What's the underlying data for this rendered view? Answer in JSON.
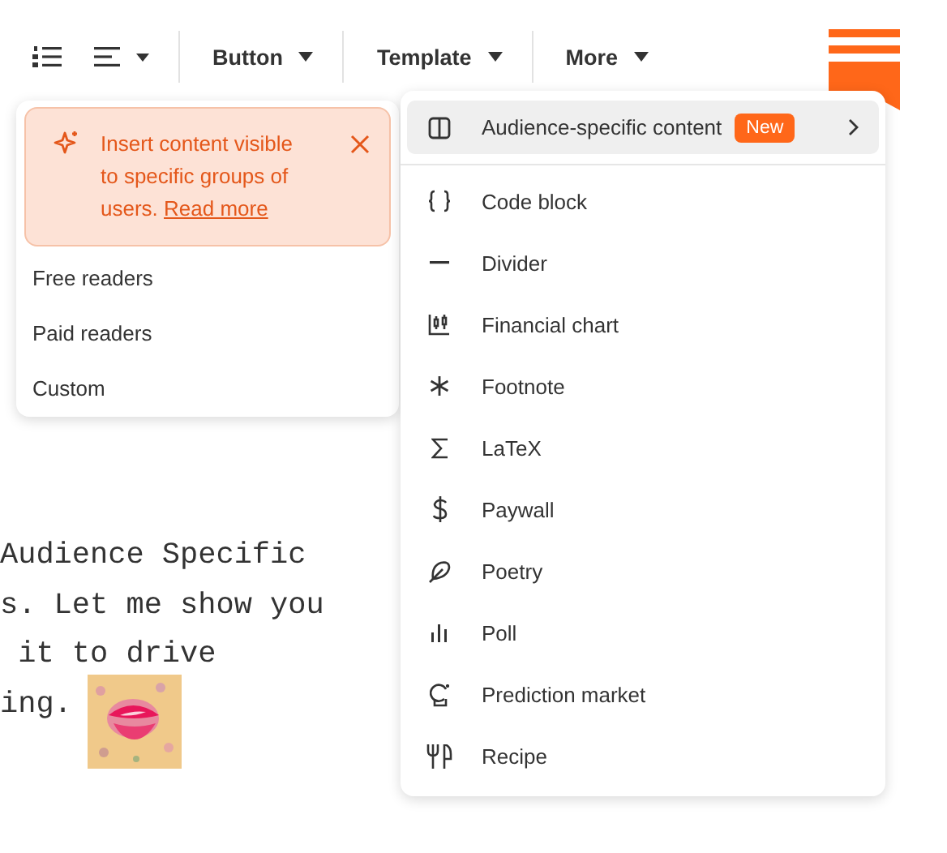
{
  "toolbar": {
    "items": [
      {
        "kind": "numbered-list"
      },
      {
        "kind": "align"
      },
      {
        "kind": "dropdown",
        "label": "Button"
      },
      {
        "kind": "dropdown",
        "label": "Template"
      },
      {
        "kind": "dropdown",
        "label": "More"
      }
    ]
  },
  "body_lines": [
    "Audience Specific",
    "s. Let me show you",
    " it to drive",
    "ing."
  ],
  "body_picture": {
    "kind": "picture"
  },
  "audience_popup": {
    "callout": {
      "text": "Insert content visible to specific groups of users.",
      "link": "Read more"
    },
    "options": [
      "Free readers",
      "Paid readers",
      "Custom"
    ]
  },
  "more_menu": {
    "items": [
      {
        "kind": "columns",
        "label": "Audience-specific content",
        "badge": "New",
        "submenu": true,
        "selected": true
      },
      {
        "kind": "code",
        "label": "Code block",
        "selected": false
      },
      {
        "kind": "divider",
        "label": "Divider",
        "selected": false
      },
      {
        "kind": "finance",
        "label": "Financial chart",
        "selected": false
      },
      {
        "kind": "asterisk",
        "label": "Footnote",
        "selected": false
      },
      {
        "kind": "sigma",
        "label": "LaTeX",
        "selected": false
      },
      {
        "kind": "dollar",
        "label": "Paywall",
        "selected": false
      },
      {
        "kind": "feather",
        "label": "Poetry",
        "selected": false
      },
      {
        "kind": "poll",
        "label": "Poll",
        "selected": false
      },
      {
        "kind": "crystal",
        "label": "Prediction market",
        "selected": false
      },
      {
        "kind": "recipe",
        "label": "Recipe",
        "selected": false
      }
    ]
  }
}
